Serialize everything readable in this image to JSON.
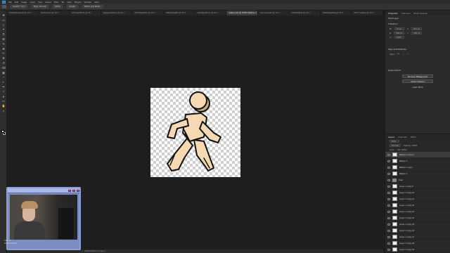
{
  "menubar": {
    "logo": "Ps",
    "items": [
      "File",
      "Edit",
      "Image",
      "Layer",
      "Type",
      "Select",
      "Filter",
      "3D",
      "View",
      "Plugins",
      "Window",
      "Help"
    ]
  },
  "options": {
    "items": [
      "Feather: 0 px",
      "Style: Normal",
      "Width:",
      "Height:",
      "Select and Mask..."
    ]
  },
  "tabs": [
    {
      "label": "ZU4wlkbsaqm8 @ 16.7...",
      "active": false
    },
    {
      "label": "Subsurface @ 16.7...",
      "active": false
    },
    {
      "label": "dirThpgd8zns @ 25...",
      "active": false
    },
    {
      "label": "illyggwesbfpsg @ 16.7...",
      "active": false
    },
    {
      "label": "dKFuhfjgd6hs @ 16.7...",
      "active": false
    },
    {
      "label": "Sdfdsfgrfg8fh @ 16.7...",
      "active": false
    },
    {
      "label": "sdfsdfgry8mrs @ 16.7...",
      "active": false
    },
    {
      "label": "walker.psd @ 100% (Ellipse 1 copy, RGB/8)",
      "active": true
    },
    {
      "label": "ciwmnqpsafx @ 16.7...",
      "active": false
    },
    {
      "label": "sdfssfdhjfdd @ 16.7...",
      "active": false
    },
    {
      "label": "hdfsdfdjfgdfdg @ 16.7...",
      "active": false
    },
    {
      "label": "2017 walking @ 16.7...",
      "active": false
    }
  ],
  "toolbar": {
    "tools": [
      "move-tool",
      "marquee-tool",
      "lasso-tool",
      "quick-select-tool",
      "crop-tool",
      "frame-tool",
      "eyedropper-tool",
      "healing-tool",
      "brush-tool",
      "stamp-tool",
      "history-brush-tool",
      "eraser-tool",
      "gradient-tool",
      "blur-tool",
      "dodge-tool",
      "pen-tool",
      "type-tool",
      "path-select-tool",
      "shape-tool",
      "hand-tool",
      "zoom-tool",
      "more-tools"
    ],
    "glyphs": [
      "✥",
      "▭",
      "ℓ",
      "✦",
      "⌗",
      "⊠",
      "✎",
      "✚",
      "✏",
      "⎈",
      "↺",
      "⌫",
      "▦",
      "◔",
      "◐",
      "✒",
      "T",
      "➤",
      "▭",
      "✋",
      "⌕",
      "…"
    ]
  },
  "status": "100%   Ellipse 1 copy 2",
  "properties": {
    "tabs": [
      "Properties",
      "Channels",
      "Brush Settings"
    ],
    "layer_kind": "Pixel Layer",
    "transform_title": "Transform",
    "w": "71 px",
    "h": "160 px",
    "x": "241 px",
    "y": "102 px",
    "angle": "0.00°",
    "align_title": "Align and Distribute",
    "align_label": "Align:",
    "quick_actions_title": "Quick Actions",
    "remove_bg": "Remove Background",
    "select_subject": "Select Subject",
    "more": "Learn More"
  },
  "layers": {
    "tabs": [
      "Layers",
      "Channels",
      "Paths"
    ],
    "kind": "Kind",
    "blend": "Normal",
    "opacity": "Opacity: 100%",
    "lock": "Lock:",
    "fill": "Fill: 100%",
    "rows": [
      {
        "name": "Ellipse 1 copy 2",
        "type": "pixel",
        "selected": true
      },
      {
        "name": "Ellipse 1",
        "type": "pixel",
        "selected": false
      },
      {
        "name": "Ellipse 1 copy",
        "type": "pixel",
        "selected": false
      },
      {
        "name": "Ellipse 1",
        "type": "pixel",
        "selected": false
      },
      {
        "name": "Feet",
        "type": "group",
        "selected": false
      },
      {
        "name": "Layer 1 copy 9",
        "type": "pixel",
        "selected": false
      },
      {
        "name": "Layer 1 copy 10",
        "type": "pixel",
        "selected": false
      },
      {
        "name": "Layer 1 copy 11",
        "type": "pixel",
        "selected": false
      },
      {
        "name": "Layer 1 copy 12",
        "type": "pixel",
        "selected": false
      },
      {
        "name": "Layer 1 copy 13",
        "type": "pixel",
        "selected": false
      },
      {
        "name": "Layer 1 copy 14",
        "type": "pixel",
        "selected": false
      },
      {
        "name": "Layer 1 copy 15",
        "type": "pixel",
        "selected": false
      },
      {
        "name": "Layer 1 copy 16",
        "type": "pixel",
        "selected": false
      },
      {
        "name": "Layer 1 copy 17",
        "type": "pixel",
        "selected": false
      },
      {
        "name": "Layer 1 copy 18",
        "type": "pixel",
        "selected": false
      },
      {
        "name": "Layer 1 copy 19",
        "type": "pixel",
        "selected": false
      }
    ]
  },
  "webcam": {
    "banner": "LIKE & SUBSCRIBE!"
  },
  "colors": {
    "figure_fill": "#f4d9b3",
    "figure_outline": "#111111",
    "accent": "#31a8ff"
  }
}
